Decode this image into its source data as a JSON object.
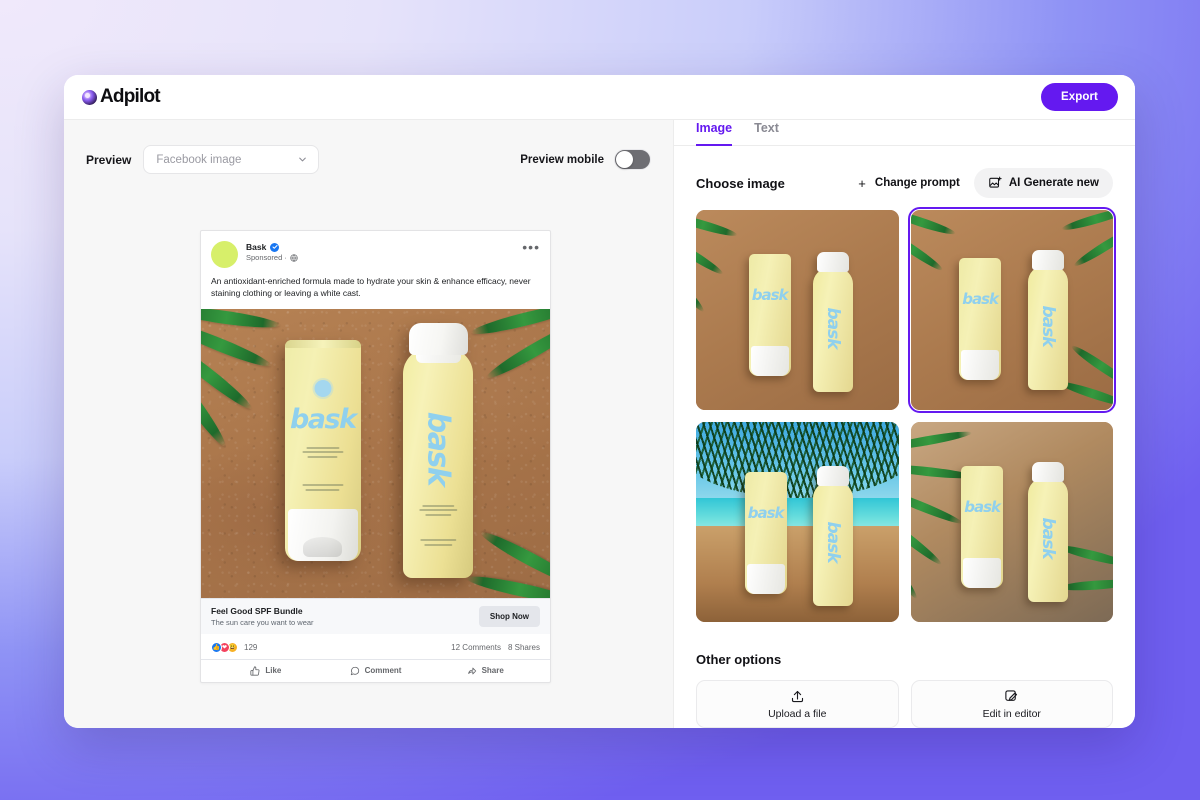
{
  "app": {
    "brand_name": "Adpilot",
    "export_label": "Export"
  },
  "preview_bar": {
    "preview_label": "Preview",
    "format_value": "Facebook image",
    "mobile_label": "Preview mobile",
    "mobile_toggle_state": "off"
  },
  "ad_preview": {
    "brand": "Bask",
    "sponsored": "Sponsored ·",
    "body_text": "An antioxidant-enriched formula made to hydrate your skin & enhance efficacy, never staining clothing or leaving a white cast.",
    "headline": "Feel Good SPF Bundle",
    "subheadline": "The sun care you want to wear",
    "cta_label": "Shop Now",
    "reaction_count": "129",
    "comments": "12 Comments",
    "shares": "8 Shares",
    "actions": [
      "Like",
      "Comment",
      "Share"
    ],
    "menu_glyph": "•••"
  },
  "right_panel": {
    "tabs": [
      {
        "label": "Image",
        "active": true
      },
      {
        "label": "Text",
        "active": false
      }
    ],
    "choose_title": "Choose image",
    "change_prompt_label": "Change prompt",
    "change_prompt_plus": "+",
    "ai_generate_label": "AI Generate new",
    "images": [
      {
        "alt": "Sunscreen tube and spray on sand with palm frond, left",
        "selected": false,
        "scene": "sand-palm-left"
      },
      {
        "alt": "Sunscreen tube and spray on sand with palm fronds, selected",
        "selected": true,
        "scene": "sand-palm-top"
      },
      {
        "alt": "Sunscreen tube and spray on tropical beach with ocean",
        "selected": false,
        "scene": "beach-ocean"
      },
      {
        "alt": "Sunscreen tube and spray on sand with large palm frond",
        "selected": false,
        "scene": "sand-palm-big"
      }
    ],
    "other_options_title": "Other options",
    "other_options": [
      {
        "label": "Upload a file",
        "icon": "upload-icon"
      },
      {
        "label": "Edit in editor",
        "icon": "edit-image-icon"
      }
    ]
  },
  "colors": {
    "accent": "#6419f0",
    "tab_active": "#6419f0",
    "toggle_track": "#6e6e73",
    "panel_bg": "#f7f7f7"
  }
}
